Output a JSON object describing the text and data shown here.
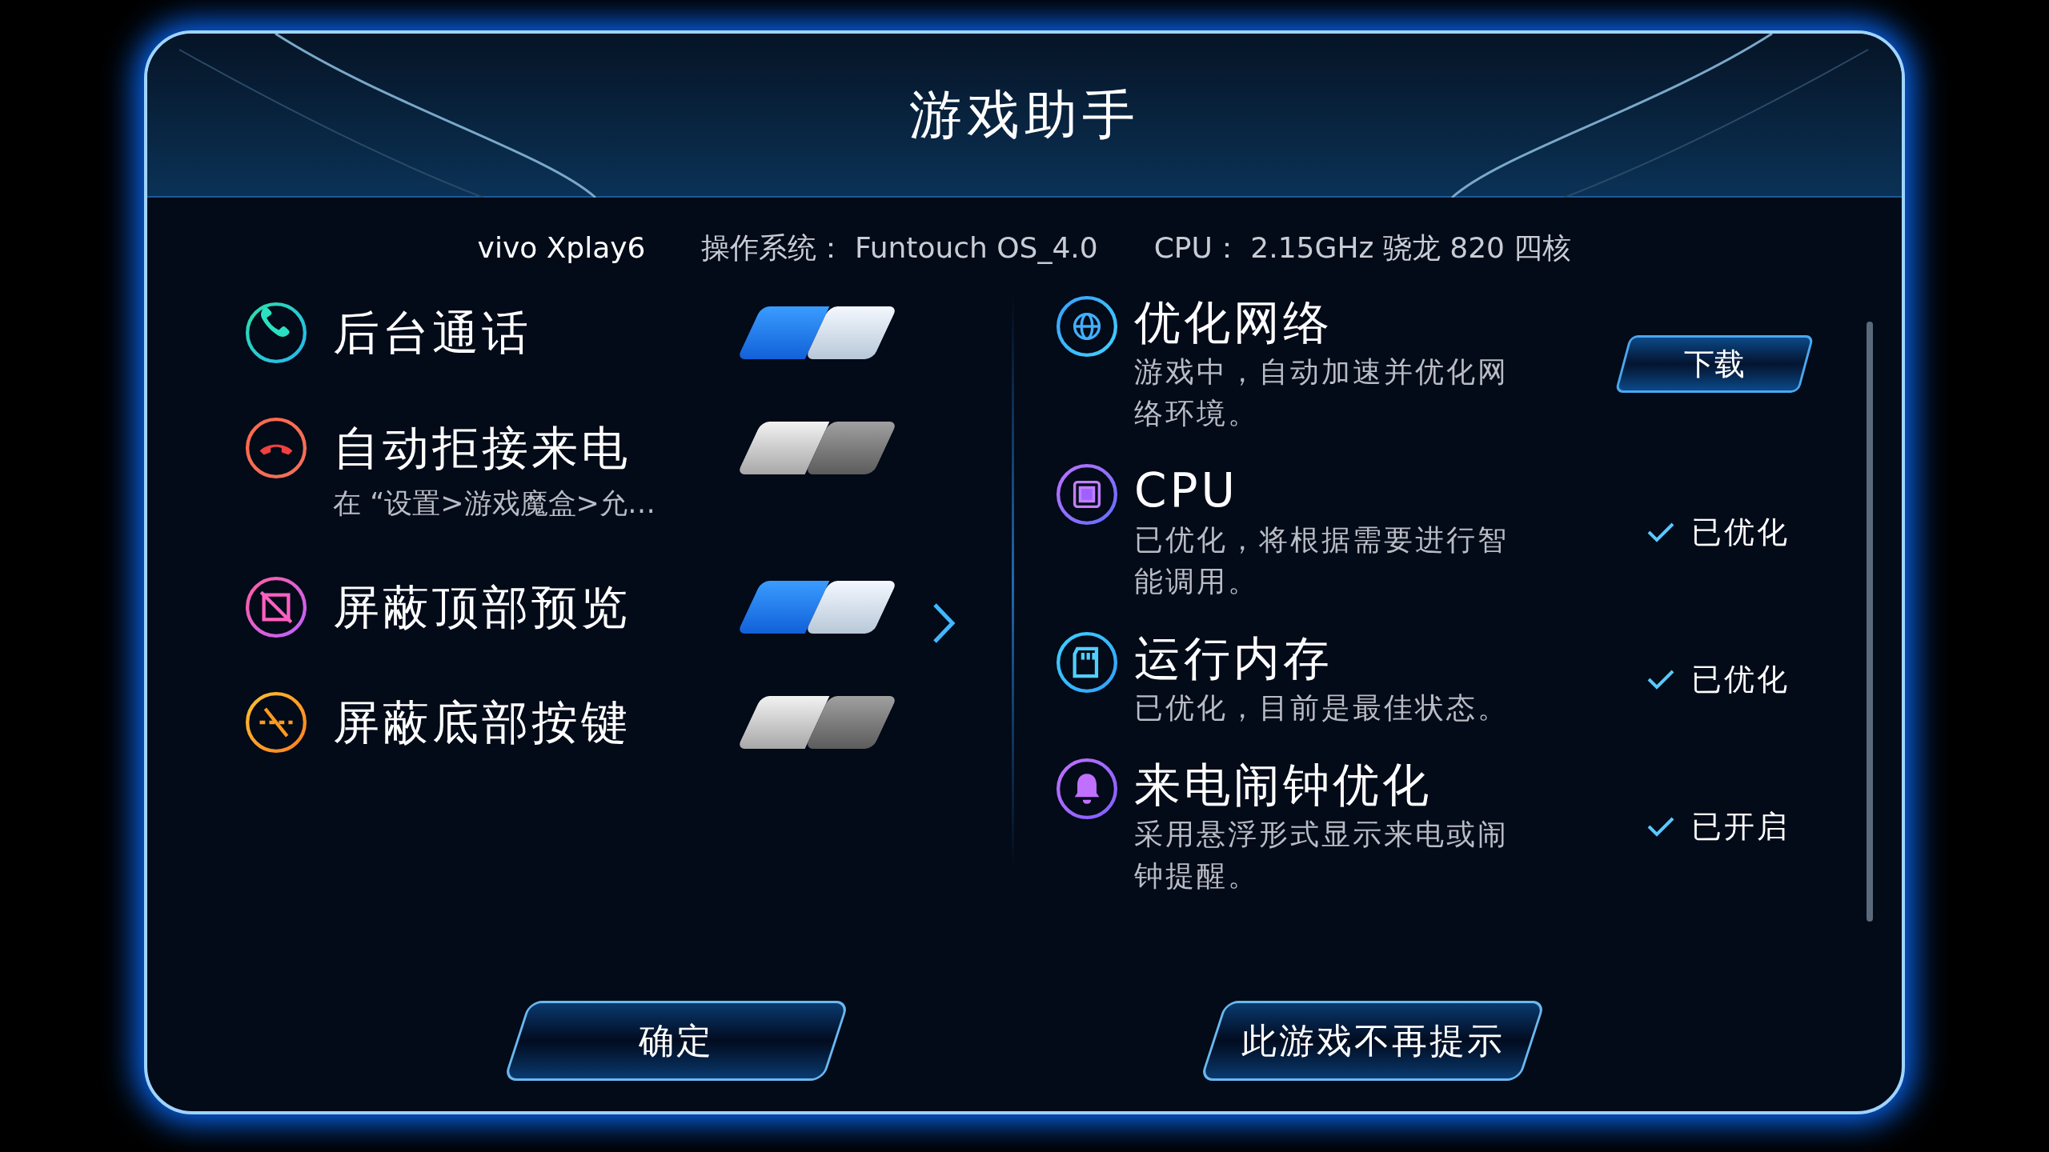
{
  "window": {
    "title": "游戏助手"
  },
  "device_info": [
    "vivo Xplay6",
    "操作系统： Funtouch OS_4.0",
    "CPU： 2.15GHz 骁龙 820 四核"
  ],
  "settings": [
    {
      "label": "后台通话",
      "on": true
    },
    {
      "label": "自动拒接来电",
      "subtitle": "在 “设置>游戏魔盒>允…",
      "on": false
    },
    {
      "label": "屏蔽顶部预览",
      "on": true
    },
    {
      "label": "屏蔽底部按键",
      "on": false
    }
  ],
  "optimizations": [
    {
      "title": "优化网络",
      "description": "游戏中，自动加速并优化网络环境。",
      "kind": "button",
      "action": "下载"
    },
    {
      "title": "CPU",
      "description": "已优化，将根据需要进行智能调用。",
      "kind": "status",
      "status": "已优化"
    },
    {
      "title": "运行内存",
      "description": "已优化，目前是最佳状态。",
      "kind": "status",
      "status": "已优化"
    },
    {
      "title": "来电闹钟优化",
      "description": "采用悬浮形式显示来电或闹钟提醒。",
      "kind": "status",
      "status": "已开启"
    }
  ],
  "buttons": [
    "确定",
    "此游戏不再提示"
  ]
}
